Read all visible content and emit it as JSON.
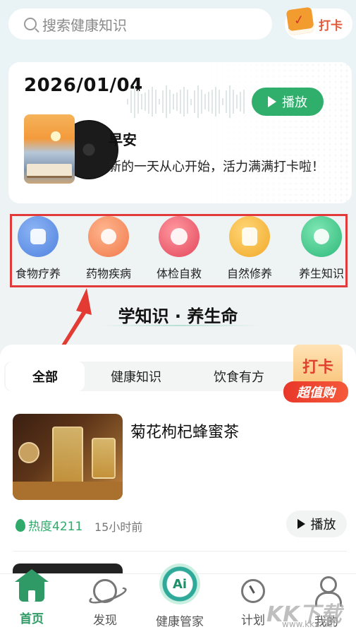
{
  "search": {
    "placeholder": "搜索健康知识",
    "icon": "search-icon"
  },
  "checkin": {
    "label": "打卡",
    "icon": "calendar-check-icon"
  },
  "daily_card": {
    "date": "2026/01/04",
    "play_label": "播放",
    "greeting": "早安",
    "message": "新的一天从心开始，活力满满打卡啦！"
  },
  "categories": [
    {
      "label": "食物疗养",
      "color": "#5b8fe6",
      "icon": "food-icon"
    },
    {
      "label": "药物疾病",
      "color": "#f58a5a",
      "icon": "medicine-bag-icon"
    },
    {
      "label": "体检自救",
      "color": "#ef5c6a",
      "icon": "clock-icon"
    },
    {
      "label": "自然修养",
      "color": "#f3b43a",
      "icon": "note-icon"
    },
    {
      "label": "养生知识",
      "color": "#3dc58a",
      "icon": "check-icon"
    }
  ],
  "section_heading": "学知识 · 养生命",
  "tabs": [
    {
      "label": "全部",
      "active": true
    },
    {
      "label": "健康知识",
      "active": false
    },
    {
      "label": "饮食有方",
      "active": false
    }
  ],
  "promo": {
    "top": "打卡",
    "bottom": "超值购"
  },
  "item": {
    "title": "菊花枸杞蜂蜜茶",
    "heat": "热度4211",
    "ago": "15小时前",
    "play_label": "播放"
  },
  "nav": [
    {
      "label": "首页",
      "icon": "home-icon",
      "active": true
    },
    {
      "label": "发现",
      "icon": "planet-icon",
      "active": false
    },
    {
      "label": "健康管家",
      "icon": "ai-icon",
      "active": false,
      "icon_text": "Ai"
    },
    {
      "label": "计划",
      "icon": "timer-icon",
      "active": false
    },
    {
      "label": "我的",
      "icon": "user-icon",
      "active": false
    }
  ],
  "watermark": {
    "text": "KK下载",
    "url": "www.kkx.net"
  },
  "accent_color": "#2faa6a"
}
